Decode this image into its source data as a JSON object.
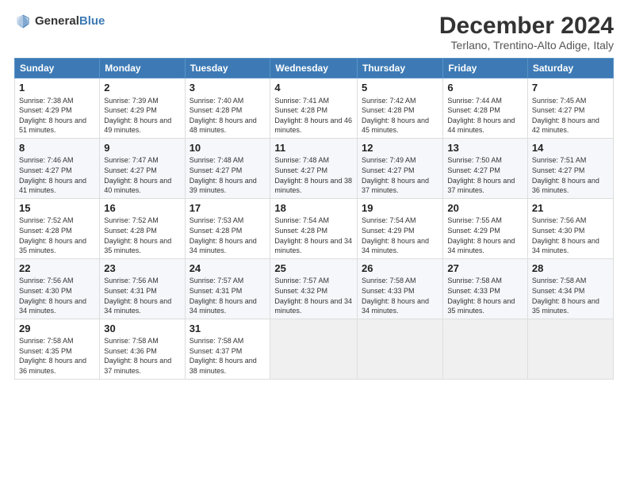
{
  "logo": {
    "text_general": "General",
    "text_blue": "Blue"
  },
  "title": "December 2024",
  "location": "Terlano, Trentino-Alto Adige, Italy",
  "headers": [
    "Sunday",
    "Monday",
    "Tuesday",
    "Wednesday",
    "Thursday",
    "Friday",
    "Saturday"
  ],
  "weeks": [
    [
      {
        "day": "1",
        "sunrise": "Sunrise: 7:38 AM",
        "sunset": "Sunset: 4:29 PM",
        "daylight": "Daylight: 8 hours and 51 minutes."
      },
      {
        "day": "2",
        "sunrise": "Sunrise: 7:39 AM",
        "sunset": "Sunset: 4:29 PM",
        "daylight": "Daylight: 8 hours and 49 minutes."
      },
      {
        "day": "3",
        "sunrise": "Sunrise: 7:40 AM",
        "sunset": "Sunset: 4:28 PM",
        "daylight": "Daylight: 8 hours and 48 minutes."
      },
      {
        "day": "4",
        "sunrise": "Sunrise: 7:41 AM",
        "sunset": "Sunset: 4:28 PM",
        "daylight": "Daylight: 8 hours and 46 minutes."
      },
      {
        "day": "5",
        "sunrise": "Sunrise: 7:42 AM",
        "sunset": "Sunset: 4:28 PM",
        "daylight": "Daylight: 8 hours and 45 minutes."
      },
      {
        "day": "6",
        "sunrise": "Sunrise: 7:44 AM",
        "sunset": "Sunset: 4:28 PM",
        "daylight": "Daylight: 8 hours and 44 minutes."
      },
      {
        "day": "7",
        "sunrise": "Sunrise: 7:45 AM",
        "sunset": "Sunset: 4:27 PM",
        "daylight": "Daylight: 8 hours and 42 minutes."
      }
    ],
    [
      {
        "day": "8",
        "sunrise": "Sunrise: 7:46 AM",
        "sunset": "Sunset: 4:27 PM",
        "daylight": "Daylight: 8 hours and 41 minutes."
      },
      {
        "day": "9",
        "sunrise": "Sunrise: 7:47 AM",
        "sunset": "Sunset: 4:27 PM",
        "daylight": "Daylight: 8 hours and 40 minutes."
      },
      {
        "day": "10",
        "sunrise": "Sunrise: 7:48 AM",
        "sunset": "Sunset: 4:27 PM",
        "daylight": "Daylight: 8 hours and 39 minutes."
      },
      {
        "day": "11",
        "sunrise": "Sunrise: 7:48 AM",
        "sunset": "Sunset: 4:27 PM",
        "daylight": "Daylight: 8 hours and 38 minutes."
      },
      {
        "day": "12",
        "sunrise": "Sunrise: 7:49 AM",
        "sunset": "Sunset: 4:27 PM",
        "daylight": "Daylight: 8 hours and 37 minutes."
      },
      {
        "day": "13",
        "sunrise": "Sunrise: 7:50 AM",
        "sunset": "Sunset: 4:27 PM",
        "daylight": "Daylight: 8 hours and 37 minutes."
      },
      {
        "day": "14",
        "sunrise": "Sunrise: 7:51 AM",
        "sunset": "Sunset: 4:27 PM",
        "daylight": "Daylight: 8 hours and 36 minutes."
      }
    ],
    [
      {
        "day": "15",
        "sunrise": "Sunrise: 7:52 AM",
        "sunset": "Sunset: 4:28 PM",
        "daylight": "Daylight: 8 hours and 35 minutes."
      },
      {
        "day": "16",
        "sunrise": "Sunrise: 7:52 AM",
        "sunset": "Sunset: 4:28 PM",
        "daylight": "Daylight: 8 hours and 35 minutes."
      },
      {
        "day": "17",
        "sunrise": "Sunrise: 7:53 AM",
        "sunset": "Sunset: 4:28 PM",
        "daylight": "Daylight: 8 hours and 34 minutes."
      },
      {
        "day": "18",
        "sunrise": "Sunrise: 7:54 AM",
        "sunset": "Sunset: 4:28 PM",
        "daylight": "Daylight: 8 hours and 34 minutes."
      },
      {
        "day": "19",
        "sunrise": "Sunrise: 7:54 AM",
        "sunset": "Sunset: 4:29 PM",
        "daylight": "Daylight: 8 hours and 34 minutes."
      },
      {
        "day": "20",
        "sunrise": "Sunrise: 7:55 AM",
        "sunset": "Sunset: 4:29 PM",
        "daylight": "Daylight: 8 hours and 34 minutes."
      },
      {
        "day": "21",
        "sunrise": "Sunrise: 7:56 AM",
        "sunset": "Sunset: 4:30 PM",
        "daylight": "Daylight: 8 hours and 34 minutes."
      }
    ],
    [
      {
        "day": "22",
        "sunrise": "Sunrise: 7:56 AM",
        "sunset": "Sunset: 4:30 PM",
        "daylight": "Daylight: 8 hours and 34 minutes."
      },
      {
        "day": "23",
        "sunrise": "Sunrise: 7:56 AM",
        "sunset": "Sunset: 4:31 PM",
        "daylight": "Daylight: 8 hours and 34 minutes."
      },
      {
        "day": "24",
        "sunrise": "Sunrise: 7:57 AM",
        "sunset": "Sunset: 4:31 PM",
        "daylight": "Daylight: 8 hours and 34 minutes."
      },
      {
        "day": "25",
        "sunrise": "Sunrise: 7:57 AM",
        "sunset": "Sunset: 4:32 PM",
        "daylight": "Daylight: 8 hours and 34 minutes."
      },
      {
        "day": "26",
        "sunrise": "Sunrise: 7:58 AM",
        "sunset": "Sunset: 4:33 PM",
        "daylight": "Daylight: 8 hours and 34 minutes."
      },
      {
        "day": "27",
        "sunrise": "Sunrise: 7:58 AM",
        "sunset": "Sunset: 4:33 PM",
        "daylight": "Daylight: 8 hours and 35 minutes."
      },
      {
        "day": "28",
        "sunrise": "Sunrise: 7:58 AM",
        "sunset": "Sunset: 4:34 PM",
        "daylight": "Daylight: 8 hours and 35 minutes."
      }
    ],
    [
      {
        "day": "29",
        "sunrise": "Sunrise: 7:58 AM",
        "sunset": "Sunset: 4:35 PM",
        "daylight": "Daylight: 8 hours and 36 minutes."
      },
      {
        "day": "30",
        "sunrise": "Sunrise: 7:58 AM",
        "sunset": "Sunset: 4:36 PM",
        "daylight": "Daylight: 8 hours and 37 minutes."
      },
      {
        "day": "31",
        "sunrise": "Sunrise: 7:58 AM",
        "sunset": "Sunset: 4:37 PM",
        "daylight": "Daylight: 8 hours and 38 minutes."
      },
      null,
      null,
      null,
      null
    ]
  ]
}
